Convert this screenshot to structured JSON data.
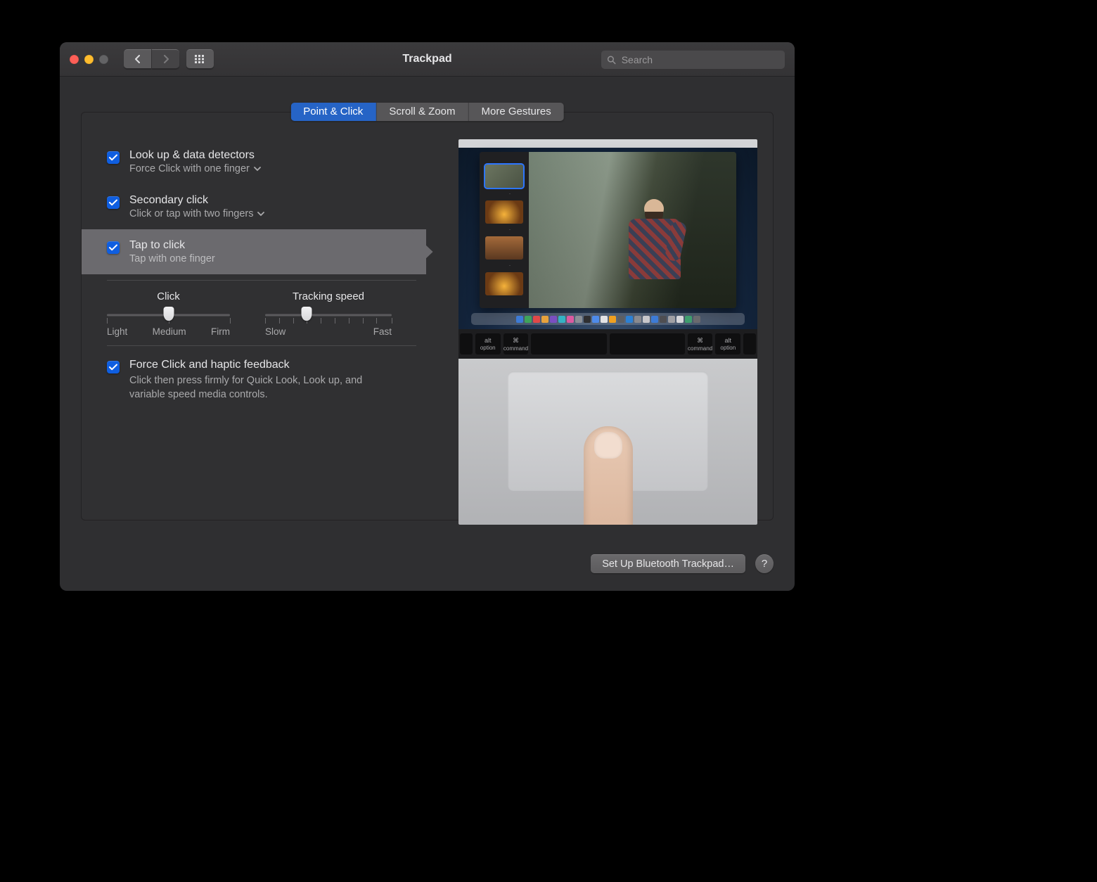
{
  "window": {
    "title": "Trackpad"
  },
  "toolbar": {
    "search_placeholder": "Search"
  },
  "tabs": [
    {
      "label": "Point & Click",
      "active": true
    },
    {
      "label": "Scroll & Zoom",
      "active": false
    },
    {
      "label": "More Gestures",
      "active": false
    }
  ],
  "options": {
    "lookup": {
      "title": "Look up & data detectors",
      "sub": "Force Click with one finger",
      "checked": true,
      "has_menu": true
    },
    "secondary": {
      "title": "Secondary click",
      "sub": "Click or tap with two fingers",
      "checked": true,
      "has_menu": true
    },
    "tap": {
      "title": "Tap to click",
      "sub": "Tap with one finger",
      "checked": true,
      "selected": true
    }
  },
  "sliders": {
    "click": {
      "title": "Click",
      "labels": [
        "Light",
        "Medium",
        "Firm"
      ],
      "value_index": 1,
      "ticks": 3
    },
    "tracking": {
      "title": "Tracking speed",
      "labels": [
        "Slow",
        "Fast"
      ],
      "value_index": 3,
      "ticks": 10
    }
  },
  "force_click": {
    "title": "Force Click and haptic feedback",
    "desc": "Click then press firmly for Quick Look, Look up, and variable speed media controls.",
    "checked": true
  },
  "keyboard_keys": [
    "option",
    "command",
    "",
    "",
    "command",
    "option",
    ""
  ],
  "footer": {
    "setup_button": "Set Up Bluetooth Trackpad…",
    "help": "?"
  },
  "dock_colors": [
    "#3d7bd6",
    "#3fa35a",
    "#e04848",
    "#e6a23c",
    "#7a4fc1",
    "#34b2c4",
    "#db5aa0",
    "#8b9096",
    "#2f2f31",
    "#4e8bea",
    "#e2e2e4",
    "#f0a020",
    "#5d5f63",
    "#2c80d4",
    "#8a8a8e",
    "#c7c7cb",
    "#3d7bd6",
    "#4e4e52",
    "#a0a0a4",
    "#d6d6da",
    "#3f9d6e",
    "#6a6a6e"
  ]
}
